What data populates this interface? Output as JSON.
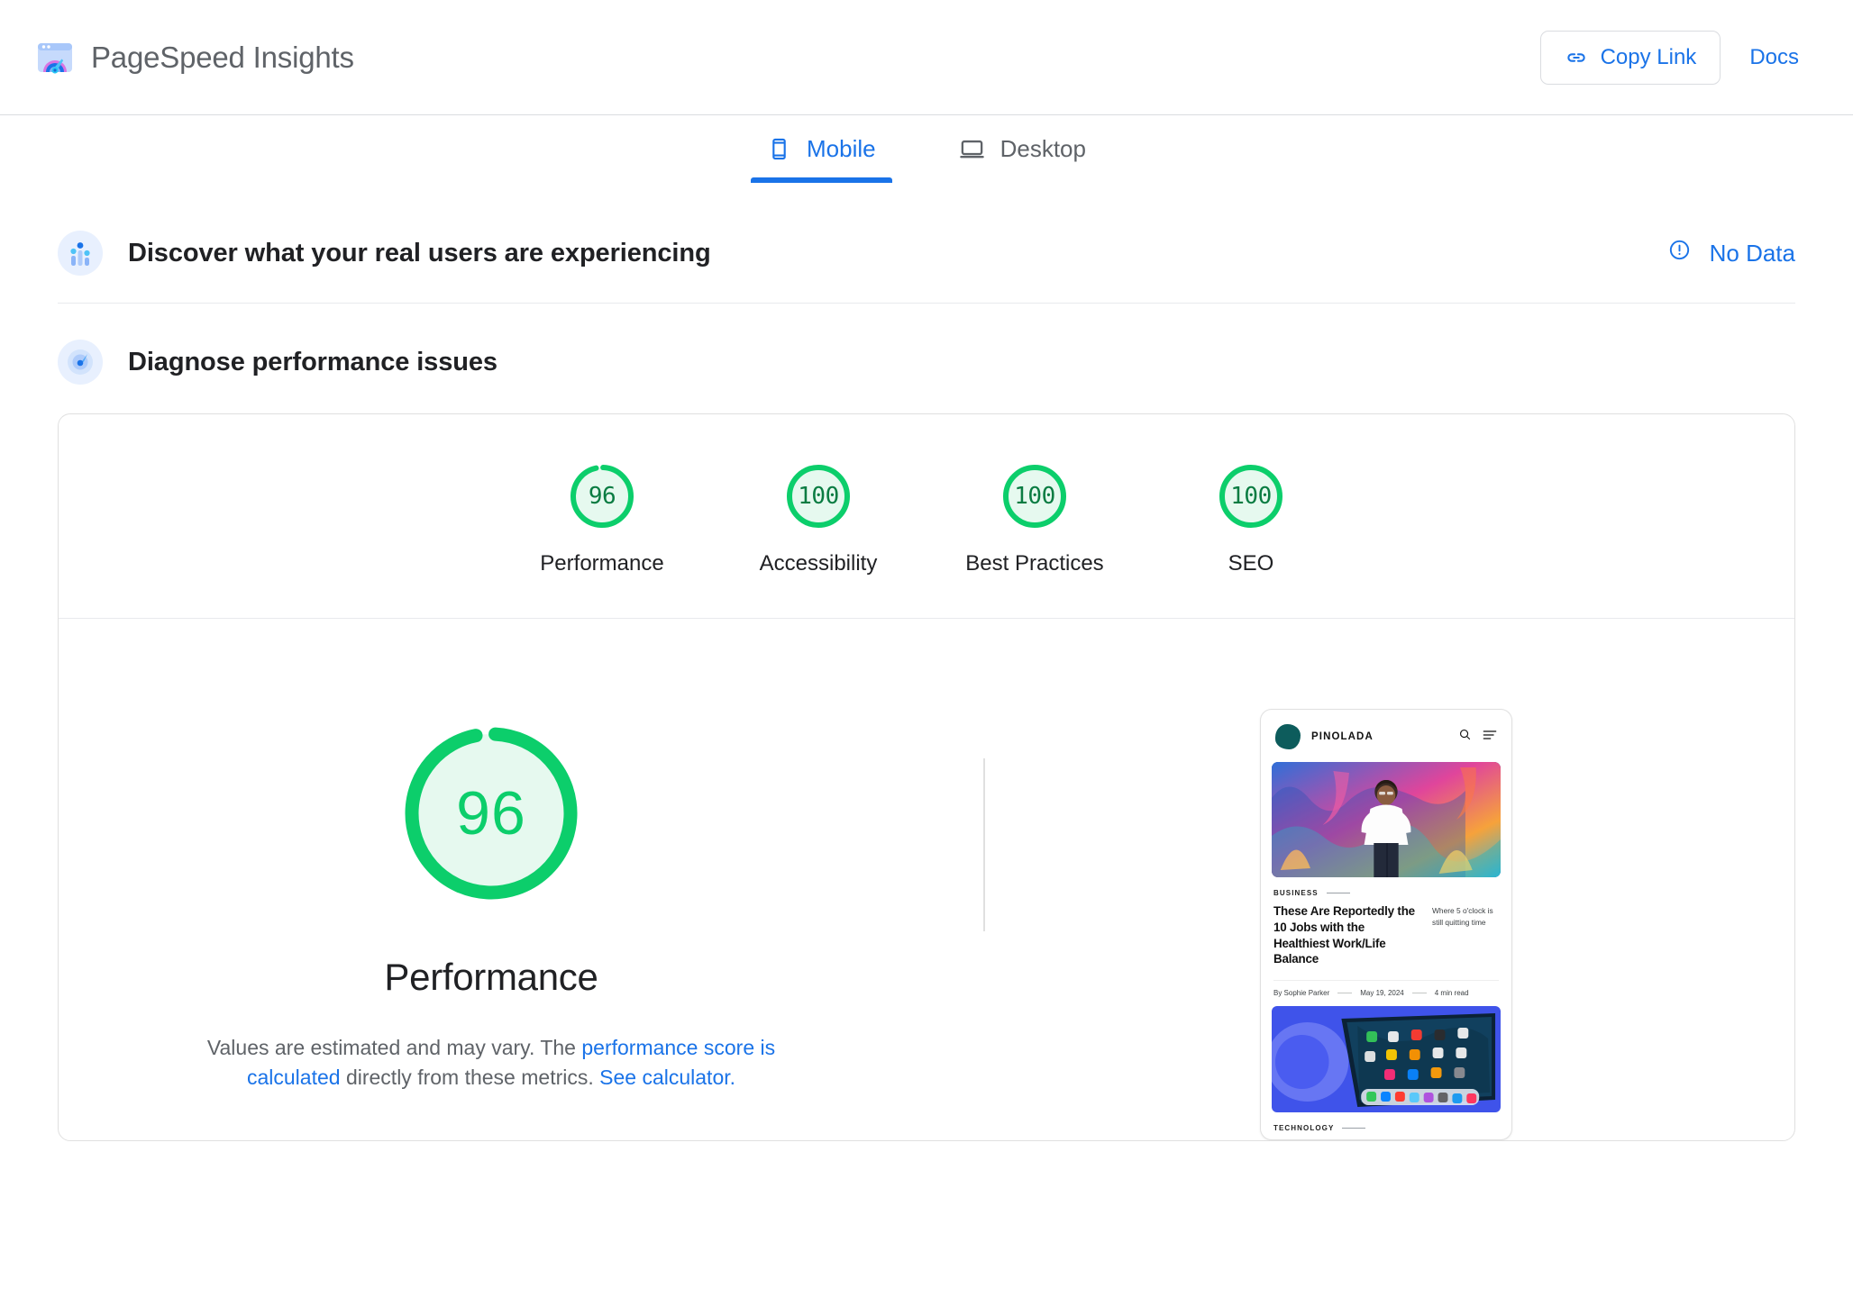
{
  "header": {
    "title": "PageSpeed Insights",
    "logo_icon": "pagespeed-logo-icon",
    "copy_link_label": "Copy Link",
    "copy_link_icon": "link-icon",
    "docs_label": "Docs"
  },
  "tabs": [
    {
      "label": "Mobile",
      "icon": "phone-icon",
      "active": true
    },
    {
      "label": "Desktop",
      "icon": "monitor-icon",
      "active": false
    }
  ],
  "sections": {
    "field_data": {
      "title": "Discover what your real users are experiencing",
      "icon": "real-users-icon",
      "status_label": "No Data",
      "status_icon": "info-exclamation-icon"
    },
    "lab_data": {
      "title": "Diagnose performance issues",
      "icon": "gauge-needle-icon"
    }
  },
  "scores": {
    "items": [
      {
        "value": "96",
        "label": "Performance"
      },
      {
        "value": "100",
        "label": "Accessibility"
      },
      {
        "value": "100",
        "label": "Best Practices"
      },
      {
        "value": "100",
        "label": "SEO"
      }
    ]
  },
  "performance": {
    "value": "96",
    "score_pct": 96,
    "label": "Performance",
    "note_prefix": "Values are estimated and may vary. The ",
    "note_link1": "performance score is calculated",
    "note_middle": " directly from these metrics. ",
    "note_link2": "See calculator."
  },
  "thumbnail": {
    "site_name": "PINOLADA",
    "search_icon": "search-icon",
    "menu_icon": "hamburger-menu-icon",
    "logo_icon": "blob-logo-icon",
    "kicker": "BUSINESS",
    "headline": "These Are Reportedly the 10 Jobs with the Healthiest Work/Life Balance",
    "subdeck": "Where 5 o'clock is still quitting time",
    "author": "By Sophie Parker",
    "date": "May 19, 2024",
    "read_time": "4 min read",
    "kicker2": "TECHNOLOGY"
  },
  "colors": {
    "brand_blue": "#1a73e8",
    "score_green": "#0cce6b",
    "score_green_dark": "#0a7c42",
    "score_green_bg": "#e6f9ef",
    "text_dark": "#202124",
    "text_gray": "#5f6368",
    "border": "#e0e0e0"
  }
}
